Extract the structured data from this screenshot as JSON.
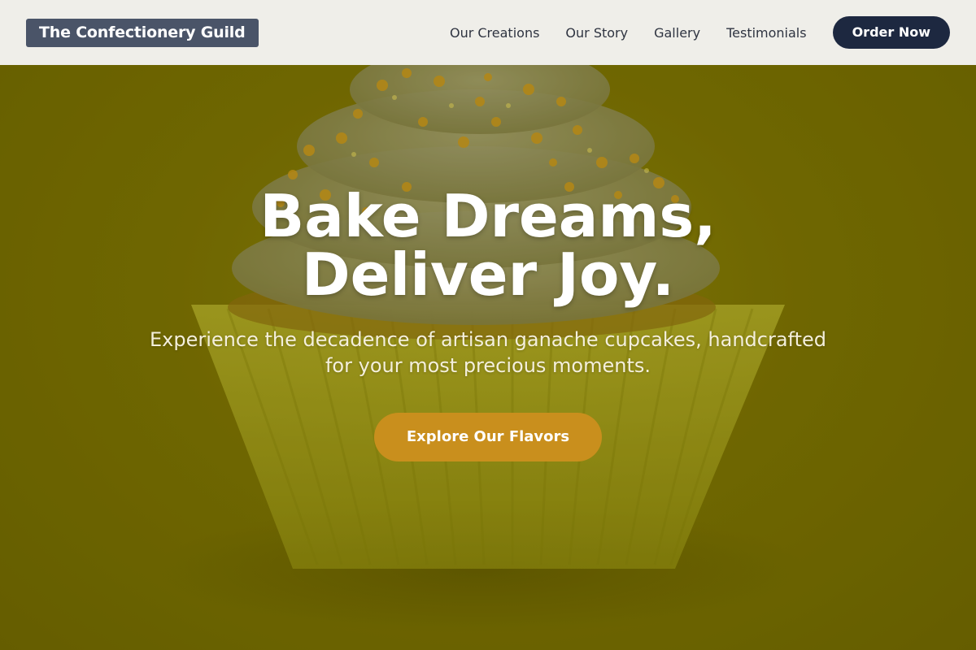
{
  "header": {
    "brand": "The Confectionery Guild",
    "nav": [
      {
        "label": "Our Creations"
      },
      {
        "label": "Our Story"
      },
      {
        "label": "Gallery"
      },
      {
        "label": "Testimonials"
      }
    ],
    "order_label": "Order Now"
  },
  "hero": {
    "headline_line1": "Bake Dreams,",
    "headline_line2": "Deliver Joy.",
    "subtext": "Experience the decadence of artisan ganache cupcakes, handcrafted for your most precious moments.",
    "cta_label": "Explore Our Flavors",
    "background_image": "cupcake-photo"
  },
  "colors": {
    "header_bg": "#efeee9",
    "brand_bg": "#4a5468",
    "order_button_bg": "#1d2840",
    "hero_overlay": "#736a02",
    "cta_bg": "#c98f1d"
  }
}
